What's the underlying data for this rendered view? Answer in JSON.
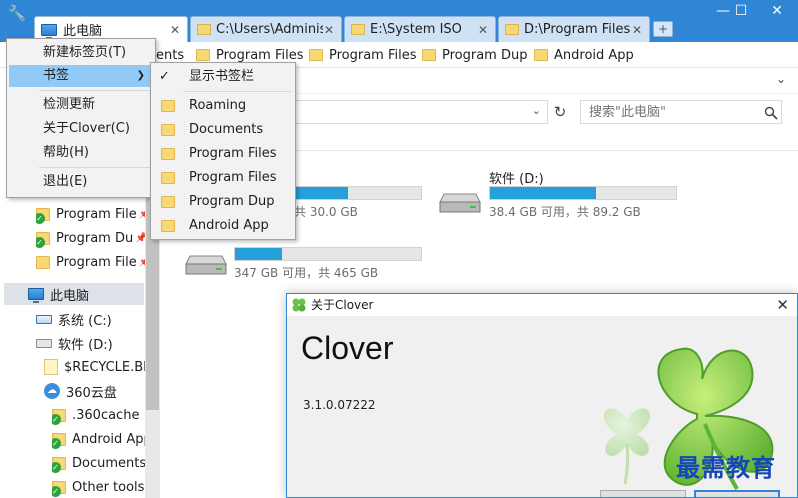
{
  "tabs": [
    {
      "label": "此电脑",
      "active": true
    },
    {
      "label": "C:\\Users\\Administ",
      "active": false
    },
    {
      "label": "E:\\System ISO",
      "active": false
    },
    {
      "label": "D:\\Program Files",
      "active": false
    }
  ],
  "window_controls": {
    "minimize": "—",
    "maximize": "☐",
    "close": "✕"
  },
  "new_tab_icon": "+",
  "bookmark_bar": {
    "items": [
      {
        "label": "ents"
      },
      {
        "label": "Program Files"
      },
      {
        "label": "Program Files"
      },
      {
        "label": "Program Dup"
      },
      {
        "label": "Android App"
      }
    ]
  },
  "address": {
    "value": ""
  },
  "search": {
    "placeholder": "搜索\"此电脑\""
  },
  "main_menu": {
    "items": [
      {
        "label": "新建标签页(T)"
      },
      {
        "label": "书签"
      },
      {
        "label": "检测更新"
      },
      {
        "label": "关于Clover(C)"
      },
      {
        "label": "帮助(H)"
      },
      {
        "label": "退出(E)"
      }
    ]
  },
  "bookmark_submenu": {
    "show_bar": {
      "label": "显示书签栏",
      "checked": true
    },
    "items": [
      {
        "label": "Roaming"
      },
      {
        "label": "Documents"
      },
      {
        "label": "Program Files"
      },
      {
        "label": "Program Files"
      },
      {
        "label": "Program Dup"
      },
      {
        "label": "Android App"
      }
    ]
  },
  "nav": {
    "quick_items": [
      {
        "label": "Program File"
      },
      {
        "label": "Program Du"
      },
      {
        "label": "Program File"
      }
    ],
    "this_pc": "此电脑",
    "drives": [
      {
        "label": "系统 (C:)"
      },
      {
        "label": "软件 (D:)"
      }
    ],
    "sub_items": [
      {
        "label": "$RECYCLE.BIN"
      },
      {
        "label": "360云盘"
      },
      {
        "label": ".360cache"
      },
      {
        "label": "Android App"
      },
      {
        "label": "Documents"
      },
      {
        "label": "Other tools"
      }
    ]
  },
  "drives_view": [
    {
      "name": "",
      "free": "，共 30.0 GB",
      "used_fraction": 0.61
    },
    {
      "name": "软件 (D:)",
      "free": "38.4 GB 可用，共 89.2 GB",
      "used_fraction": 0.57
    },
    {
      "name": "",
      "free": "347 GB 可用，共 465 GB",
      "used_fraction": 0.25
    }
  ],
  "about_dialog": {
    "title": "关于Clover",
    "app_name": "Clover",
    "version": "3.1.0.07222",
    "close": "✕"
  },
  "watermark": "最需教育",
  "colors": {
    "accent": "#2f86d4",
    "bar_fill": "#26a0da",
    "menu_hover": "#91c9f7",
    "clover_green": "#6cc04a"
  }
}
